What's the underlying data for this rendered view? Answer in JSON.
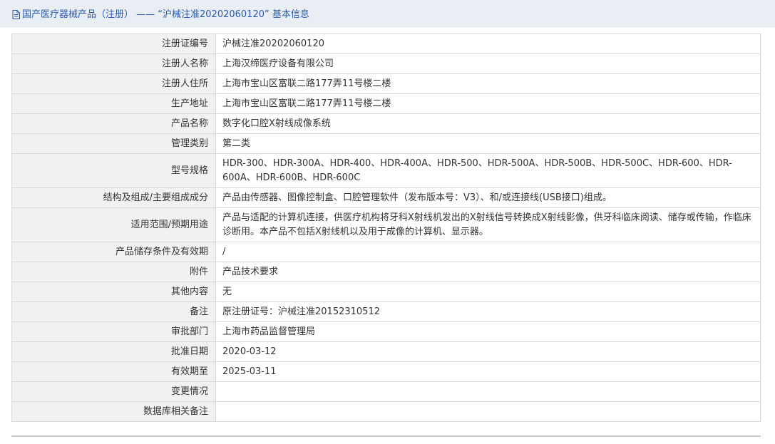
{
  "header": {
    "title": "国产医疗器械产品（注册） —— “沪械注准20202060120” 基本信息",
    "icon": "document-icon"
  },
  "rows": [
    {
      "label": "注册证编号",
      "value": "沪械注准20202060120"
    },
    {
      "label": "注册人名称",
      "value": "上海汉缔医疗设备有限公司"
    },
    {
      "label": "注册人住所",
      "value": "上海市宝山区富联二路177弄11号楼二楼"
    },
    {
      "label": "生产地址",
      "value": "上海市宝山区富联二路177弄11号楼二楼"
    },
    {
      "label": "产品名称",
      "value": "数字化口腔X射线成像系统"
    },
    {
      "label": "管理类别",
      "value": "第二类"
    },
    {
      "label": "型号规格",
      "value": "HDR-300、HDR-300A、HDR-400、HDR-400A、HDR-500、HDR-500A、HDR-500B、HDR-500C、HDR-600、HDR-600A、HDR-600B、HDR-600C"
    },
    {
      "label": "结构及组成/主要组成成分",
      "value": "产品由传感器、图像控制盒、口腔管理软件（发布版本号：V3）、和/或连接线(USB接口)组成。"
    },
    {
      "label": "适用范围/预期用途",
      "value": "产品与适配的计算机连接，供医疗机构将牙科X射线机发出的X射线信号转换成X射线影像，供牙科临床阅读、储存或传输，作临床诊断用。本产品不包括X射线机以及用于成像的计算机、显示器。"
    },
    {
      "label": "产品储存条件及有效期",
      "value": "/"
    },
    {
      "label": "附件",
      "value": "产品技术要求"
    },
    {
      "label": "其他内容",
      "value": "无"
    },
    {
      "label": "备注",
      "value": "原注册证号：沪械注准20152310512"
    },
    {
      "label": "审批部门",
      "value": "上海市药品监督管理局"
    },
    {
      "label": "批准日期",
      "value": "2020-03-12"
    },
    {
      "label": "有效期至",
      "value": "2025-03-11"
    },
    {
      "label": "变更情况",
      "value": ""
    },
    {
      "label": "数据库相关备注",
      "value": ""
    }
  ],
  "colors": {
    "title_text": "#2a5aa8",
    "label_bg": "#f1f1f1",
    "border": "#d9d9d9"
  }
}
